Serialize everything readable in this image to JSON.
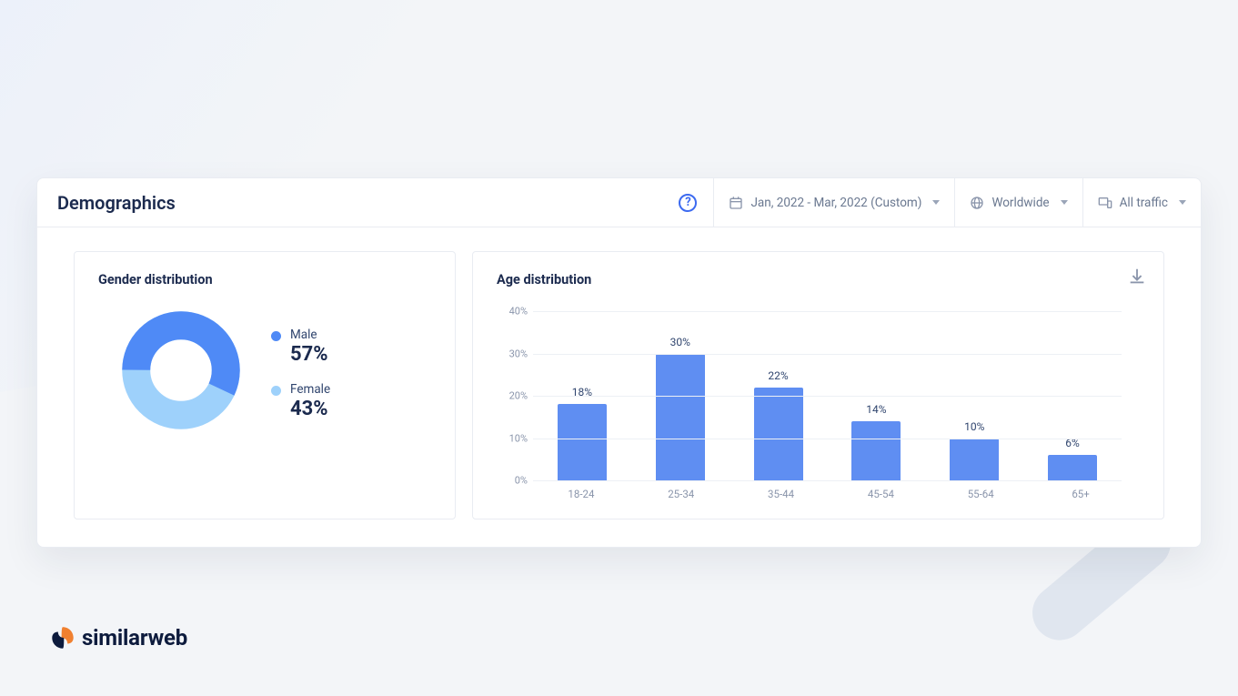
{
  "header": {
    "title": "Demographics",
    "date_range": "Jan, 2022 - Mar, 2022 (Custom)",
    "region": "Worldwide",
    "traffic": "All traffic"
  },
  "gender": {
    "title": "Gender distribution",
    "series": [
      {
        "label": "Male",
        "value_text": "57%"
      },
      {
        "label": "Female",
        "value_text": "43%"
      }
    ]
  },
  "age": {
    "title": "Age distribution",
    "y_ticks": [
      "0%",
      "10%",
      "20%",
      "30%",
      "40%"
    ],
    "bars": [
      {
        "category": "18-24",
        "value_text": "18%"
      },
      {
        "category": "25-34",
        "value_text": "30%"
      },
      {
        "category": "35-44",
        "value_text": "22%"
      },
      {
        "category": "45-54",
        "value_text": "14%"
      },
      {
        "category": "55-64",
        "value_text": "10%"
      },
      {
        "category": "65+",
        "value_text": "6%"
      }
    ]
  },
  "brand": {
    "name": "similarweb"
  },
  "colors": {
    "male": "#4f8af6",
    "female": "#9ed1fb",
    "bar": "#5f8ef2"
  },
  "chart_data": [
    {
      "type": "pie",
      "title": "Gender distribution",
      "series": [
        {
          "name": "Gender",
          "values": [
            57,
            43
          ]
        }
      ],
      "categories": [
        "Male",
        "Female"
      ]
    },
    {
      "type": "bar",
      "title": "Age distribution",
      "categories": [
        "18-24",
        "25-34",
        "35-44",
        "45-54",
        "55-64",
        "65+"
      ],
      "values": [
        18,
        30,
        22,
        14,
        10,
        6
      ],
      "xlabel": "",
      "ylabel": "",
      "ylim": [
        0,
        40
      ]
    }
  ]
}
